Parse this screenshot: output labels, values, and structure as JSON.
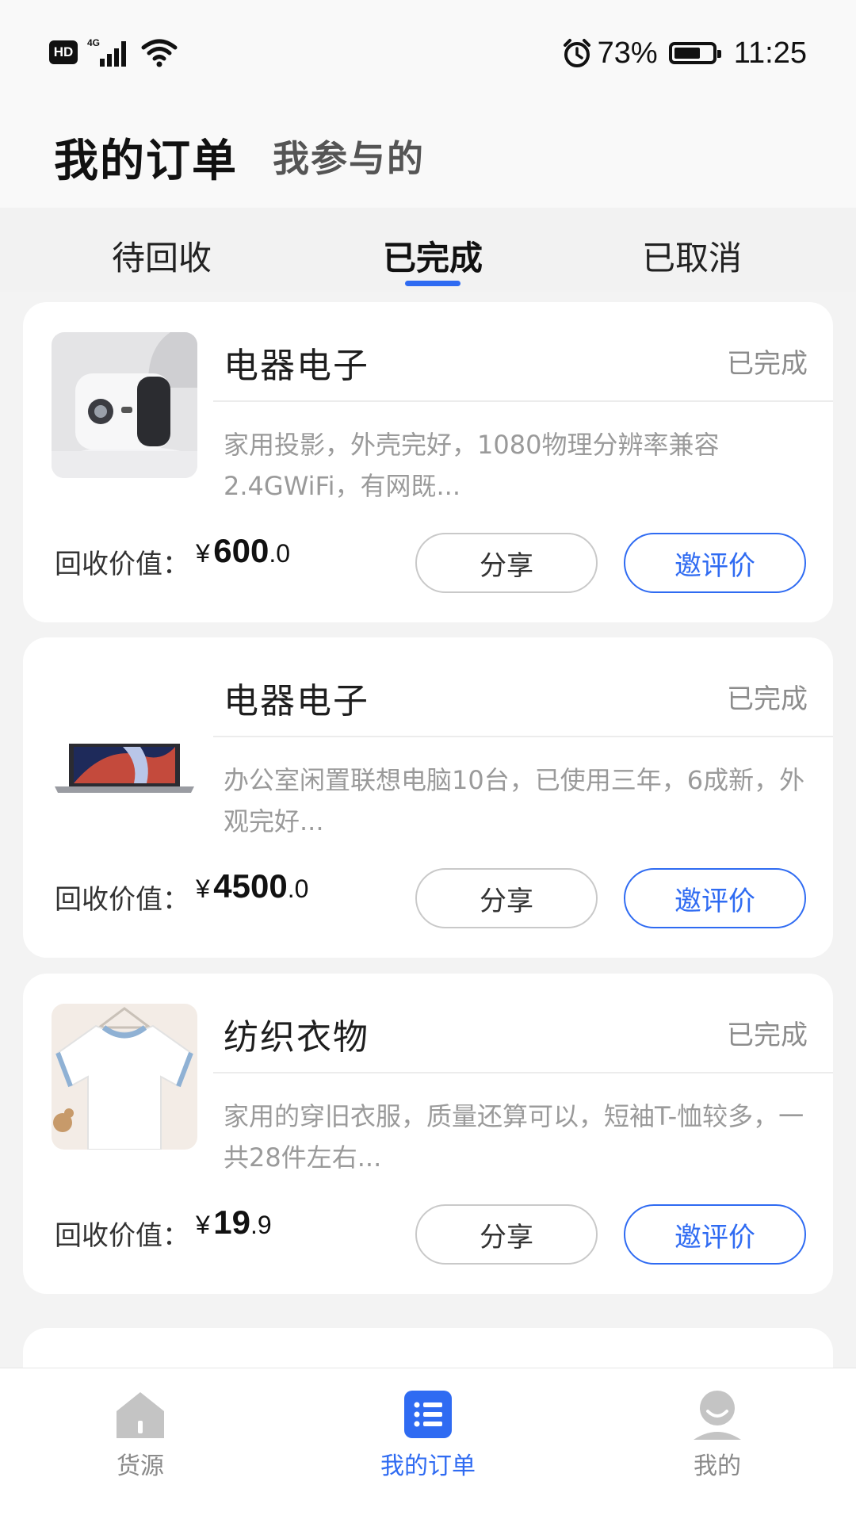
{
  "status_bar": {
    "hd": "HD",
    "network": "4G",
    "battery_percent": "73%",
    "battery_level": 0.73,
    "time": "11:25"
  },
  "header": {
    "title": "我的订单",
    "secondary": "我参与的"
  },
  "tabs": [
    {
      "label": "待回收",
      "active": false
    },
    {
      "label": "已完成",
      "active": true
    },
    {
      "label": "已取消",
      "active": false
    }
  ],
  "orders": [
    {
      "category": "电器电子",
      "status": "已完成",
      "description": "家用投影，外壳完好，1080物理分辨率兼容2.4GWiFi，有网既...",
      "price_label": "回收价值：",
      "currency": "¥",
      "price_int": "600",
      "price_dec": ".0",
      "share_label": "分享",
      "rate_label": "邀评价",
      "thumbnail": "projector-image"
    },
    {
      "category": "电器电子",
      "status": "已完成",
      "description": "办公室闲置联想电脑10台，已使用三年，6成新，外观完好...",
      "price_label": "回收价值：",
      "currency": "¥",
      "price_int": "4500",
      "price_dec": ".0",
      "share_label": "分享",
      "rate_label": "邀评价",
      "thumbnail": "laptop-image"
    },
    {
      "category": "纺织衣物",
      "status": "已完成",
      "description": "家用的穿旧衣服，质量还算可以，短袖T-恤较多，一共28件左右...",
      "price_label": "回收价值：",
      "currency": "¥",
      "price_int": "19",
      "price_dec": ".9",
      "share_label": "分享",
      "rate_label": "邀评价",
      "thumbnail": "tshirt-image"
    }
  ],
  "bottom_nav": [
    {
      "label": "货源",
      "icon": "house-icon",
      "active": false
    },
    {
      "label": "我的订单",
      "icon": "list-icon",
      "active": true
    },
    {
      "label": "我的",
      "icon": "person-icon",
      "active": false
    }
  ],
  "colors": {
    "accent": "#2f6bf2",
    "muted": "#9a9a9a",
    "background": "#f3f3f3"
  }
}
